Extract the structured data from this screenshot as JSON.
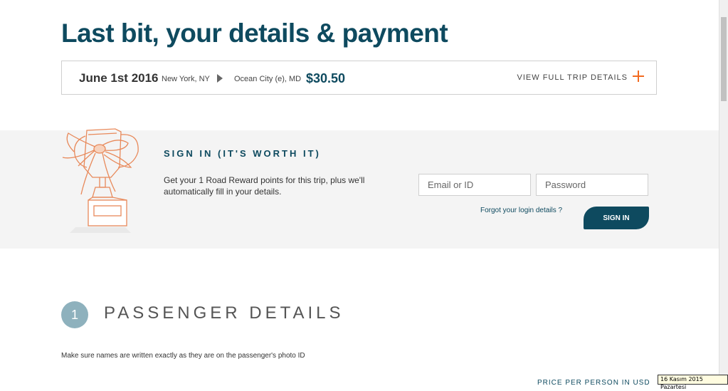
{
  "page": {
    "title": "Last bit, your details & payment"
  },
  "trip": {
    "date": "June 1st 2016",
    "from": "New York, NY",
    "to": "Ocean City (e), MD",
    "price": "$30.50",
    "details_link": "VIEW FULL TRIP DETAILS",
    "arrow_icon": "play-arrow-icon",
    "plus_icon": "plus-icon"
  },
  "signin": {
    "heading": "SIGN IN (IT'S WORTH IT)",
    "text": "Get your 1 Road Reward points for this trip, plus we'll automatically fill in your details.",
    "email_placeholder": "Email or ID",
    "password_placeholder": "Password",
    "forgot_link": "Forgot your login details ?",
    "button_label": "SIGN IN",
    "illustration": "trophy-with-bow-icon"
  },
  "passenger": {
    "step_number": "1",
    "title": "PASSENGER DETAILS",
    "note": "Make sure names are written exactly as they are on the passenger's photo ID",
    "cut_off_text": "PRICE PER PERSON IN USD"
  },
  "system": {
    "date_label": "16 Kasım 2015 Pazartesi"
  },
  "colors": {
    "brand": "#0e4a5f",
    "accent": "#f26b21",
    "step_circle": "#8eb1bd",
    "band": "#f4f4f4"
  }
}
